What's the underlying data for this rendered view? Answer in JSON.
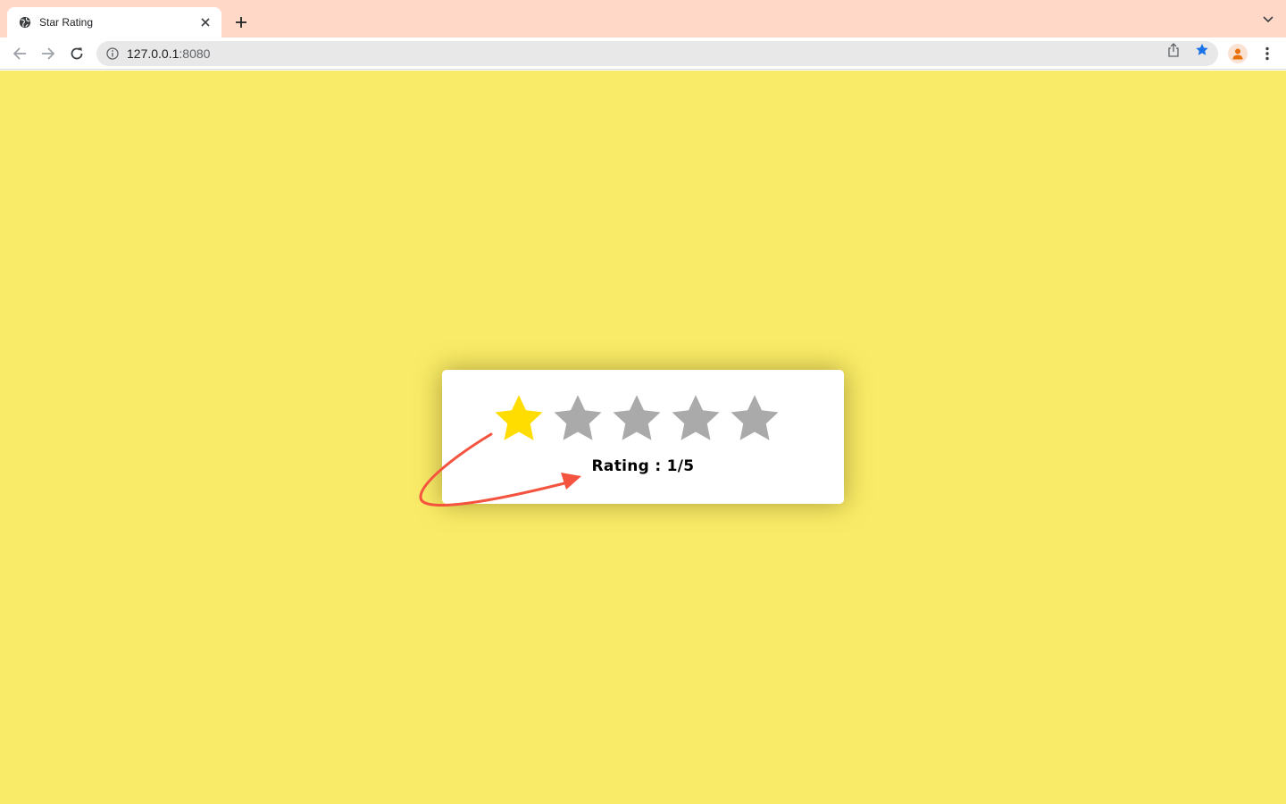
{
  "browser": {
    "tab": {
      "title": "Star Rating",
      "favicon": "globe-icon"
    },
    "address_bar": {
      "host": "127.0.0.1",
      "port": ":8080"
    },
    "icons": {
      "back": "back-arrow-icon",
      "forward": "forward-arrow-icon",
      "reload": "reload-icon",
      "site_info": "info-icon",
      "share": "share-icon",
      "bookmark": "bookmark-star-icon",
      "profile": "profile-avatar-icon",
      "menu": "kebab-menu-icon"
    },
    "colors": {
      "tabstrip": "#ffd8c8",
      "bookmark_active": "#1a73e8",
      "profile": "#e8710a"
    }
  },
  "page": {
    "background_color": "#f9ea67",
    "rating_widget": {
      "rating_prefix": "Rating : ",
      "rating_value": "1/5",
      "rating_text": "Rating : 1/5",
      "stars_total": 5,
      "stars_filled": 1,
      "filled_color": "#ffdd00",
      "empty_color": "#aaaaaa"
    },
    "annotation": {
      "type": "curved-arrow",
      "color": "#f4533f"
    }
  }
}
